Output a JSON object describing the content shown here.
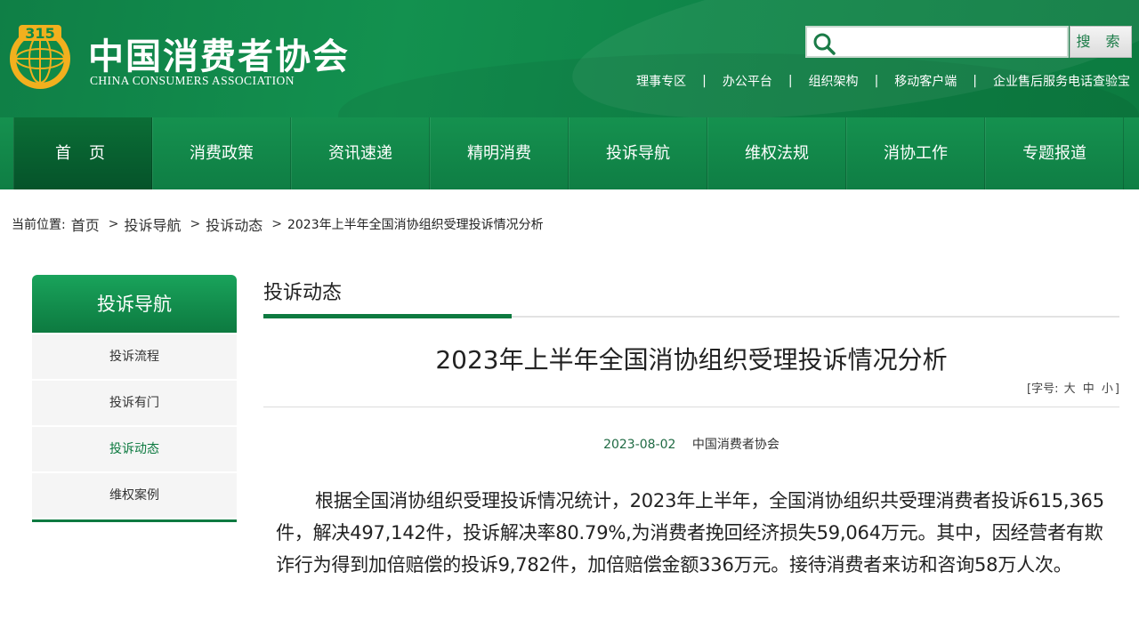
{
  "header": {
    "org_name_cn": "中国消费者协会",
    "org_name_en": "CHINA CONSUMERS ASSOCIATION",
    "logo_text": "315",
    "search": {
      "placeholder": "",
      "button_label": "搜 索"
    },
    "top_links": [
      "理事专区",
      "办公平台",
      "组织架构",
      "移动客户端",
      "企业售后服务电话查验宝"
    ]
  },
  "nav": {
    "items": [
      {
        "label": "首页",
        "active": true
      },
      {
        "label": "消费政策",
        "active": false
      },
      {
        "label": "资讯速递",
        "active": false
      },
      {
        "label": "精明消费",
        "active": false
      },
      {
        "label": "投诉导航",
        "active": false
      },
      {
        "label": "维权法规",
        "active": false
      },
      {
        "label": "消协工作",
        "active": false
      },
      {
        "label": "专题报道",
        "active": false
      }
    ]
  },
  "breadcrumb": {
    "lead": "当前位置:",
    "items": [
      "首页",
      "投诉导航",
      "投诉动态"
    ],
    "current": "2023年上半年全国消协组织受理投诉情况分析"
  },
  "sidebar": {
    "title": "投诉导航",
    "items": [
      {
        "label": "投诉流程",
        "active": false
      },
      {
        "label": "投诉有门",
        "active": false
      },
      {
        "label": "投诉动态",
        "active": true
      },
      {
        "label": "维权案例",
        "active": false
      }
    ]
  },
  "main": {
    "section_title": "投诉动态",
    "article_title": "2023年上半年全国消协组织受理投诉情况分析",
    "font_size": {
      "label_open": "[字号:",
      "options": [
        "大",
        "中",
        "小"
      ],
      "label_close": "]"
    },
    "date": "2023-08-02",
    "source": "中国消费者协会",
    "body": "根据全国消协组织受理投诉情况统计，2023年上半年，全国消协组织共受理消费者投诉615,365件，解决497,142件，投诉解决率80.79%,为消费者挽回经济损失59,064万元。其中，因经营者有欺诈行为得到加倍赔偿的投诉9,782件，加倍赔偿金额336万元。接待消费者来访和咨询58万人次。"
  },
  "colors": {
    "brand_green": "#0d7a40",
    "header_green": "#13914f",
    "logo_gold": "#f2b01e"
  }
}
